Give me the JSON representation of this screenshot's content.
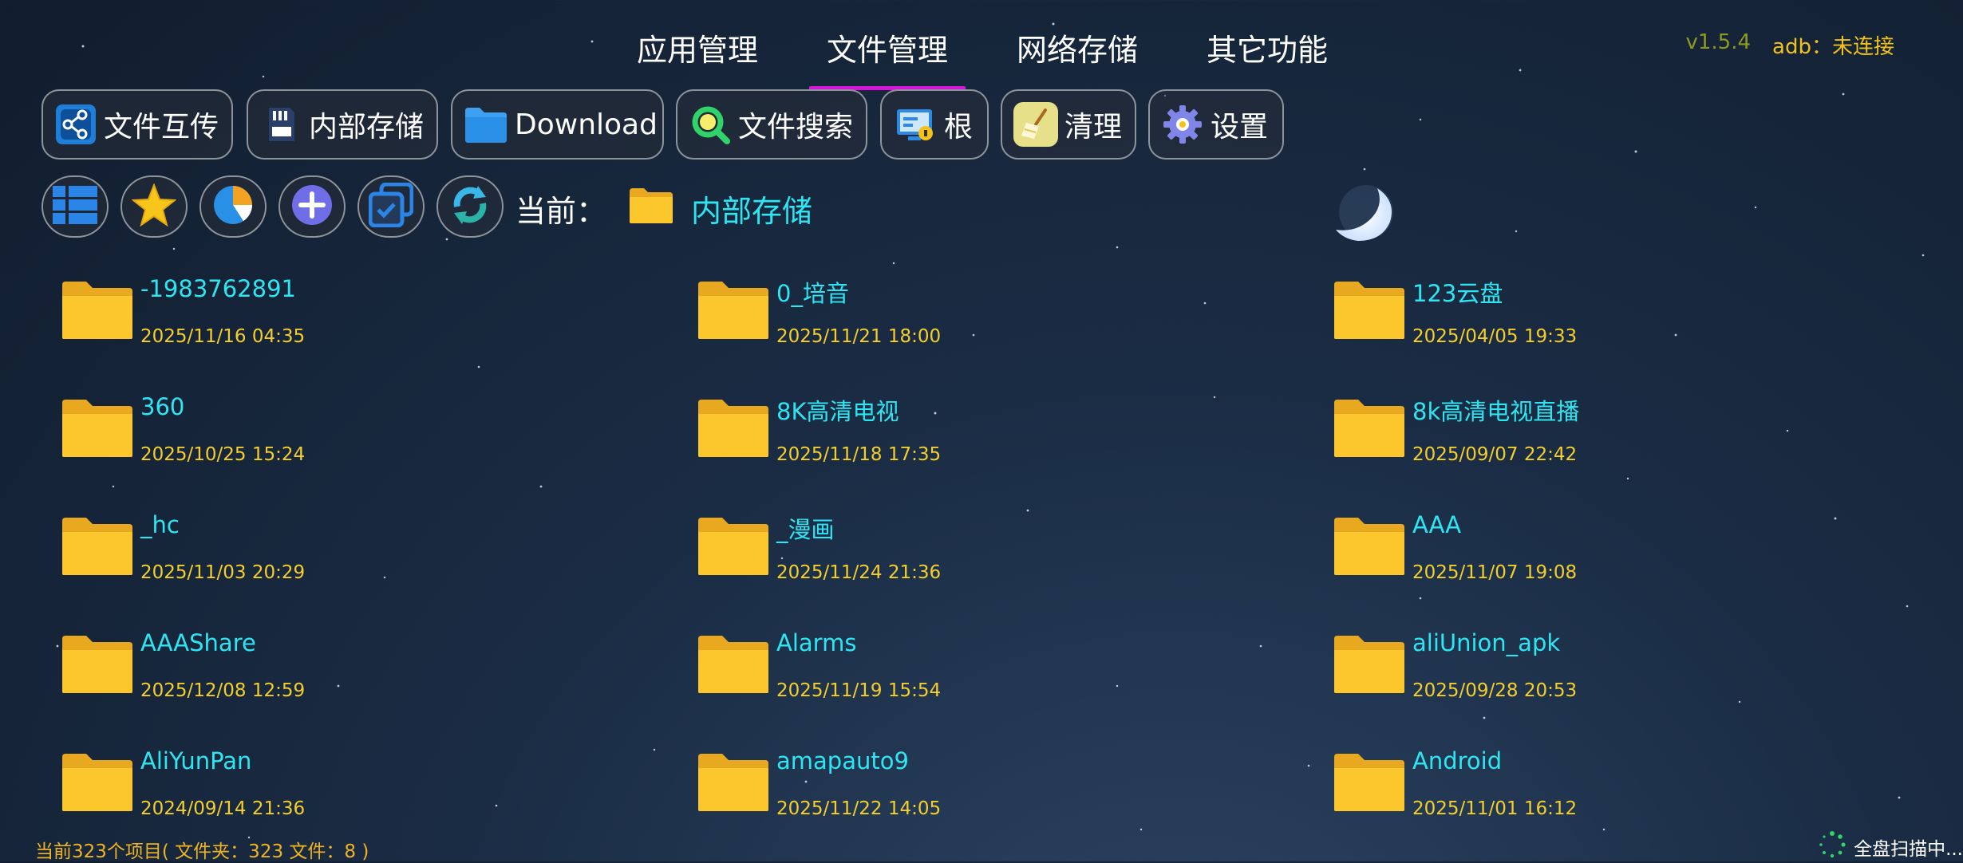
{
  "nav": {
    "tabs": [
      {
        "label": "应用管理"
      },
      {
        "label": "文件管理"
      },
      {
        "label": "网络存储"
      },
      {
        "label": "其它功能"
      }
    ],
    "active_tab": "文件管理",
    "version": "v1.5.4",
    "adb_status": "adb：未连接"
  },
  "toolbar": {
    "buttons": [
      {
        "label": "文件互传",
        "icon": "share-icon"
      },
      {
        "label": "内部存储",
        "icon": "sd-card-icon"
      },
      {
        "label": "Download",
        "icon": "folder-blue-icon"
      },
      {
        "label": "文件搜索",
        "icon": "search-icon"
      },
      {
        "label": "根",
        "icon": "root-monitor-icon"
      },
      {
        "label": "清理",
        "icon": "broom-icon"
      },
      {
        "label": "设置",
        "icon": "gear-icon"
      }
    ]
  },
  "toolbar2": {
    "buttons": [
      "list-view-icon",
      "star-icon",
      "pie-chart-icon",
      "add-icon",
      "multi-select-icon",
      "refresh-icon"
    ],
    "current_label": "当前：",
    "current_path": "内部存储"
  },
  "files": [
    {
      "name": "-1983762891",
      "date": "2025/11/16 04:35"
    },
    {
      "name": "0_培音",
      "date": "2025/11/21 18:00"
    },
    {
      "name": "123云盘",
      "date": "2025/04/05 19:33"
    },
    {
      "name": "360",
      "date": "2025/10/25 15:24"
    },
    {
      "name": "8K高清电视",
      "date": "2025/11/18 17:35"
    },
    {
      "name": "8k高清电视直播",
      "date": "2025/09/07 22:42"
    },
    {
      "name": "_hc",
      "date": "2025/11/03 20:29"
    },
    {
      "name": "_漫画",
      "date": "2025/11/24 21:36"
    },
    {
      "name": "AAA",
      "date": "2025/11/07 19:08"
    },
    {
      "name": "AAAShare",
      "date": "2025/12/08 12:59"
    },
    {
      "name": "Alarms",
      "date": "2025/11/19 15:54"
    },
    {
      "name": "aliUnion_apk",
      "date": "2025/09/28 20:53"
    },
    {
      "name": "AliYunPan",
      "date": "2024/09/14 21:36"
    },
    {
      "name": "amapauto9",
      "date": "2025/11/22 14:05"
    },
    {
      "name": "Android",
      "date": "2025/11/01 16:12"
    }
  ],
  "status": {
    "summary": "当前323个项目( 文件夹：323   文件：8 )",
    "scan_text": "全盘扫描中..."
  },
  "colors": {
    "accent_underline": "#d616d9",
    "file_name": "#2ee6f2",
    "file_date": "#f4cf2c",
    "folder": "#fcc72c"
  }
}
